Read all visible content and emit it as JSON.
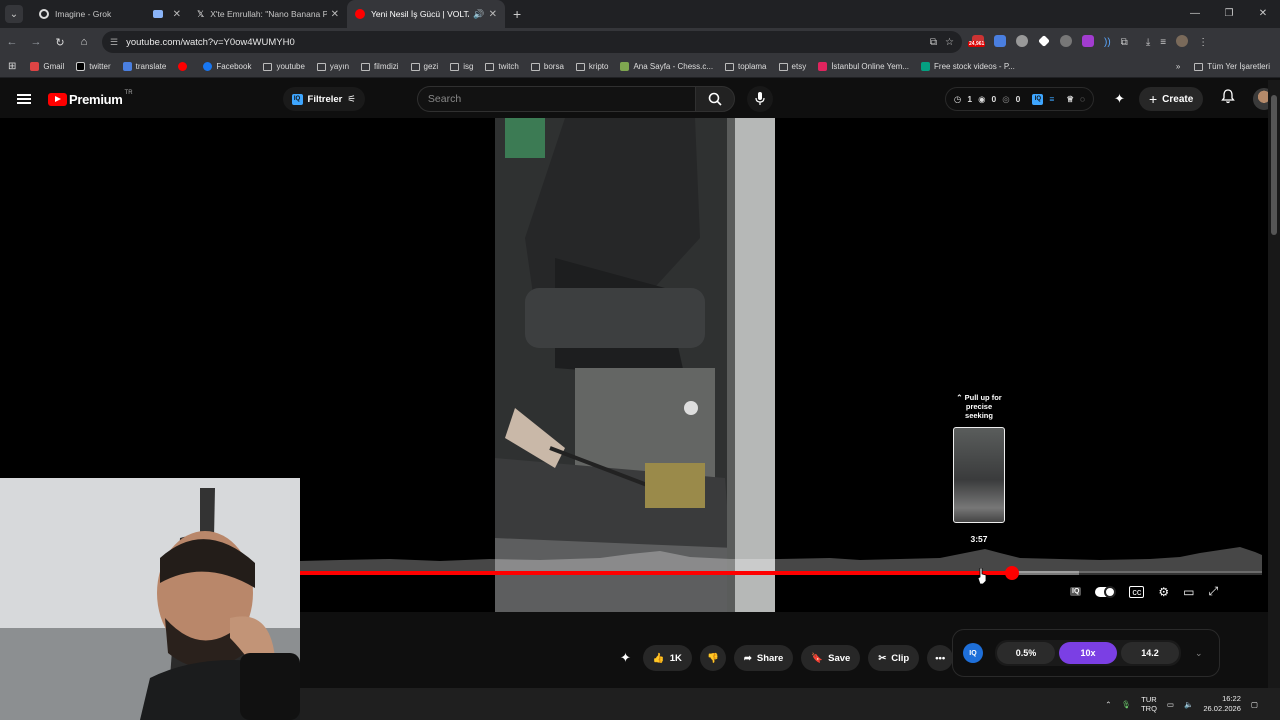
{
  "browser": {
    "tabs": [
      {
        "title": "Imagine - Grok",
        "favicon_color": "#dddddd",
        "active": false
      },
      {
        "title": "X'te Emrullah: \"Nano Banana Pr",
        "favicon_color": "#ffffff",
        "active": false
      },
      {
        "title": "Yeni Nesil İş Gücü | VOLTA V",
        "favicon_color": "#ff0000",
        "active": true
      }
    ],
    "url": "youtube.com/watch?v=Y0ow4WUMYH0",
    "bookmarks": [
      {
        "label": "Gmail",
        "icon": "gmail-icon"
      },
      {
        "label": "twitter",
        "icon": "x-icon"
      },
      {
        "label": "translate",
        "icon": "translate-icon"
      },
      {
        "label": "",
        "icon": "youtube-icon"
      },
      {
        "label": "Facebook",
        "icon": "facebook-icon"
      },
      {
        "label": "youtube",
        "icon": "folder-icon"
      },
      {
        "label": "yayın",
        "icon": "folder-icon"
      },
      {
        "label": "filmdizi",
        "icon": "folder-icon"
      },
      {
        "label": "gezi",
        "icon": "folder-icon"
      },
      {
        "label": "isg",
        "icon": "folder-icon"
      },
      {
        "label": "twitch",
        "icon": "folder-icon"
      },
      {
        "label": "borsa",
        "icon": "folder-icon"
      },
      {
        "label": "kripto",
        "icon": "folder-icon"
      },
      {
        "label": "Ana Sayfa - Chess.c...",
        "icon": "chess-icon"
      },
      {
        "label": "toplama",
        "icon": "folder-icon"
      },
      {
        "label": "etsy",
        "icon": "folder-icon"
      },
      {
        "label": "İstanbul Online Yem...",
        "icon": "yemek-icon"
      },
      {
        "label": "Free stock videos - P...",
        "icon": "pexels-icon"
      }
    ],
    "all_bookmarks_label": "Tüm Yer İşaretleri",
    "notification_badge": "24,961"
  },
  "youtube": {
    "logo_text": "Premium",
    "region": "TR",
    "filters_label": "Filtreler",
    "search_placeholder": "Search",
    "stats": {
      "clock": "1",
      "eye": "0",
      "eye_off": "0"
    },
    "create_label": "Create",
    "player": {
      "seek_hint": "Pull up for precise seeking",
      "hover_time": "3:57",
      "progress_played": 0.74,
      "progress_buffered": 0.81
    },
    "actions": {
      "like_count": "1K",
      "share_label": "Share",
      "save_label": "Save",
      "clip_label": "Clip"
    },
    "iq_panel": {
      "logo": "IQ",
      "value1": "0.5%",
      "value2": "10x",
      "value3": "14.2"
    }
  },
  "taskbar": {
    "lang_top": "TUR",
    "lang_bottom": "TRQ",
    "time": "16:22",
    "date": "26.02.2026"
  }
}
